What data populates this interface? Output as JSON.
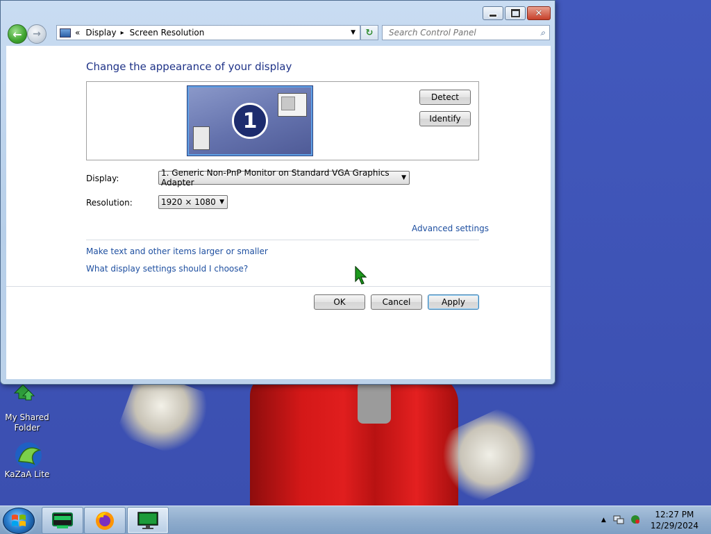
{
  "window": {
    "breadcrumb": {
      "overflow": "«",
      "item1": "Display",
      "separator": "▸",
      "item2": "Screen Resolution"
    },
    "search_placeholder": "Search Control Panel",
    "heading": "Change the appearance of your display",
    "preview": {
      "monitor_number": "1",
      "detect_label": "Detect",
      "identify_label": "Identify"
    },
    "display_label": "Display:",
    "display_value": "1. Generic Non-PnP Monitor on Standard VGA Graphics Adapter",
    "resolution_label": "Resolution:",
    "resolution_value": "1920 × 1080",
    "advanced_link": "Advanced settings",
    "links": [
      "Make text and other items larger or smaller",
      "What display settings should I choose?"
    ],
    "buttons": {
      "ok": "OK",
      "cancel": "Cancel",
      "apply": "Apply"
    }
  },
  "desktop": {
    "icons": [
      {
        "label_line1": "My Shared",
        "label_line2": "Folder",
        "icon": "shared-folder-icon"
      },
      {
        "label_line1": "KaZaA Lite",
        "icon": "kazaa-icon"
      }
    ]
  },
  "taskbar": {
    "pinned": [
      "terminal-app-icon",
      "firefox-icon",
      "display-settings-icon"
    ],
    "clock": {
      "time": "12:27 PM",
      "date": "12/29/2024"
    },
    "tray": [
      "show-hidden-icons",
      "network-icon",
      "security-icon"
    ]
  },
  "colors": {
    "accent_link": "#1e4fa0",
    "heading": "#1e3287",
    "desktop": "#3f52b3"
  }
}
